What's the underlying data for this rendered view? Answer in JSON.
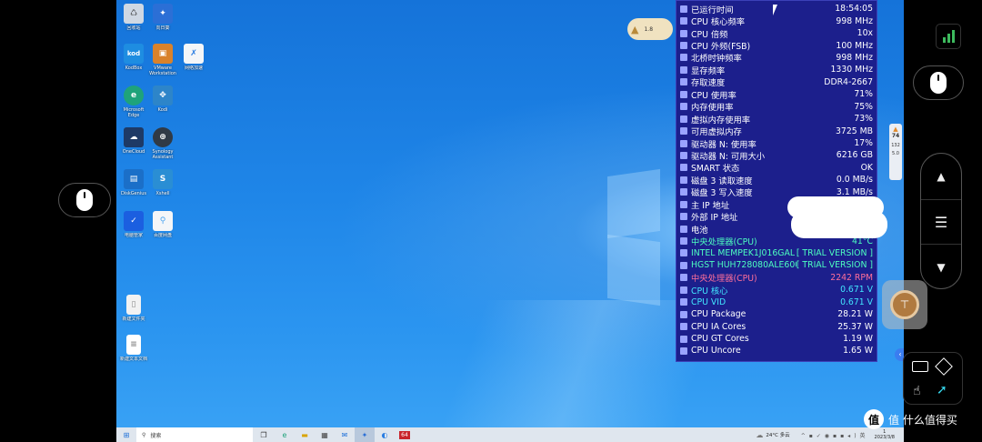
{
  "desktop_icons": [
    {
      "label": "回收站",
      "color": "#cfd8e3"
    },
    {
      "label": "向日葵",
      "color": "#2b6fd6"
    },
    {
      "label": "KodBox",
      "color": "#1e8de1",
      "text": "kod"
    },
    {
      "label": "VMware Workstation",
      "color": "#d9822b"
    },
    {
      "label": "网络加速",
      "color": "#3a9ee8"
    },
    {
      "label": "Microsoft Edge",
      "color": "#1fa37a"
    },
    {
      "label": "Kodi",
      "color": "#2d85c9"
    },
    {
      "label": "OneCloud",
      "color": "#1e3a66"
    },
    {
      "label": "Synology Assistant",
      "color": "#303a46"
    },
    {
      "label": "DiskGenius",
      "color": "#1b6fc8"
    },
    {
      "label": "Xshell",
      "color": "#2a8ed4"
    },
    {
      "label": "电脑管家",
      "color": "#1b5fe0"
    },
    {
      "label": "百度网盘",
      "color": "#4aa3f0"
    },
    {
      "label": "新建文件夹",
      "color": "#f2f2f2"
    },
    {
      "label": "新建文本文档",
      "color": "#ffffff"
    }
  ],
  "floating_badge": "1.8",
  "monitor_rows": [
    {
      "label": "已运行时间",
      "value": "18:54:05",
      "tone": "white"
    },
    {
      "label": "CPU 核心频率",
      "value": "998 MHz",
      "tone": "white"
    },
    {
      "label": "CPU 倍频",
      "value": "10x",
      "tone": "white"
    },
    {
      "label": "CPU 外频(FSB)",
      "value": "100 MHz",
      "tone": "white"
    },
    {
      "label": "北桥时钟频率",
      "value": "998 MHz",
      "tone": "white"
    },
    {
      "label": "显存频率",
      "value": "1330 MHz",
      "tone": "white"
    },
    {
      "label": "存取速度",
      "value": "DDR4-2667",
      "tone": "white"
    },
    {
      "label": "CPU 使用率",
      "value": "71%",
      "tone": "white"
    },
    {
      "label": "内存使用率",
      "value": "75%",
      "tone": "white"
    },
    {
      "label": "虚拟内存使用率",
      "value": "73%",
      "tone": "white"
    },
    {
      "label": "可用虚拟内存",
      "value": "3725 MB",
      "tone": "white"
    },
    {
      "label": "驱动器 N: 使用率",
      "value": "17%",
      "tone": "white"
    },
    {
      "label": "驱动器 N: 可用大小",
      "value": "6216 GB",
      "tone": "white"
    },
    {
      "label": "SMART 状态",
      "value": "OK",
      "tone": "white"
    },
    {
      "label": "磁盘 3 读取速度",
      "value": "0.0 MB/s",
      "tone": "white"
    },
    {
      "label": "磁盘 3 写入速度",
      "value": "3.1 MB/s",
      "tone": "white"
    },
    {
      "label": "主 IP 地址",
      "value": "",
      "tone": "white"
    },
    {
      "label": "外部 IP 地址",
      "value": "",
      "tone": "white"
    },
    {
      "label": "电池",
      "value": "",
      "tone": "white"
    },
    {
      "label": "中央处理器(CPU)",
      "value": "41°C",
      "tone": "green"
    },
    {
      "label": "INTEL MEMPEK1J016GAL",
      "value": "[ TRIAL VERSION ]",
      "tone": "green"
    },
    {
      "label": "HGST HUH728080ALE600",
      "value": "[ TRIAL VERSION ]",
      "tone": "green"
    },
    {
      "label": "中央处理器(CPU)",
      "value": "2242 RPM",
      "tone": "red"
    },
    {
      "label": "CPU 核心",
      "value": "0.671 V",
      "tone": "cyan"
    },
    {
      "label": "CPU VID",
      "value": "0.671 V",
      "tone": "cyan"
    },
    {
      "label": "CPU Package",
      "value": "28.21 W",
      "tone": "white"
    },
    {
      "label": "CPU IA Cores",
      "value": "25.37 W",
      "tone": "white"
    },
    {
      "label": "CPU GT Cores",
      "value": "1.19 W",
      "tone": "white"
    },
    {
      "label": "CPU Uncore",
      "value": "1.65 W",
      "tone": "white"
    }
  ],
  "side_widget": {
    "percent": "74",
    "line1": "132",
    "line2": "5.0"
  },
  "taskbar": {
    "search_label": "搜索",
    "badge": "64",
    "weather": "24°C 多云",
    "time": "1",
    "date": "2023/3/8"
  },
  "watermark": "值 什么值得买",
  "colors": {
    "monitor_bg": "#1c1f8c",
    "signal": "#3dbb5e"
  }
}
